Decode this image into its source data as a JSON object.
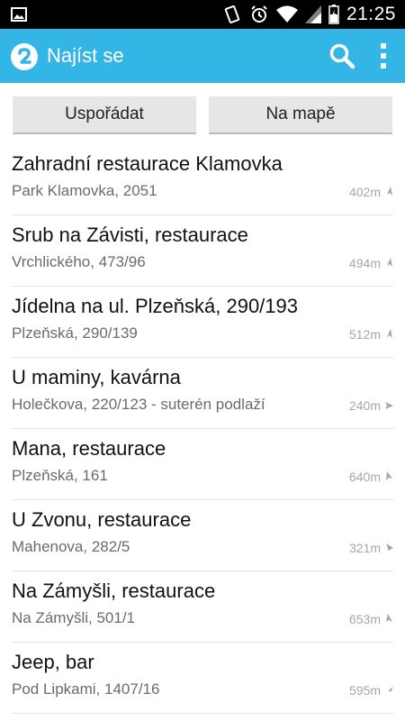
{
  "status_bar": {
    "time": "21:25",
    "icons": [
      "image-icon",
      "vibrate-icon",
      "alarm-icon",
      "wifi-icon",
      "signal-icon",
      "battery-icon"
    ]
  },
  "action_bar": {
    "title": "Najíst se",
    "app_icon": "app-logo-icon",
    "search_icon": "search-icon",
    "overflow_icon": "overflow-menu-icon",
    "color": "#33b5e5"
  },
  "buttons": {
    "sort_label": "Uspořádat",
    "map_label": "Na mapě"
  },
  "restaurants": [
    {
      "name": "Zahradní restaurace Klamovka",
      "address": "Park Klamovka, 2051",
      "distance": "402m",
      "direction_icon": "direction-arrow-icon"
    },
    {
      "name": "Srub na Závisti, restaurace",
      "address": "Vrchlického, 473/96",
      "distance": "494m",
      "direction_icon": "direction-arrow-icon"
    },
    {
      "name": "Jídelna na ul. Plzeňská, 290/193",
      "address": "Plzeňská, 290/139",
      "distance": "512m",
      "direction_icon": "direction-arrow-icon"
    },
    {
      "name": "U maminy, kavárna",
      "address": "Holečkova, 220/123 - suterén podlaží",
      "distance": "240m",
      "direction_icon": "direction-arrow-icon"
    },
    {
      "name": "Mana, restaurace",
      "address": "Plzeňská, 161",
      "distance": "640m",
      "direction_icon": "direction-arrow-icon"
    },
    {
      "name": "U Zvonu, restaurace",
      "address": "Mahenova, 282/5",
      "distance": "321m",
      "direction_icon": "direction-arrow-icon"
    },
    {
      "name": "Na Zámyšli, restaurace",
      "address": "Na Zámyšli, 501/1",
      "distance": "653m",
      "direction_icon": "direction-arrow-icon"
    },
    {
      "name": "Jeep, bar",
      "address": "Pod Lipkami, 1407/16",
      "distance": "595m",
      "direction_icon": "direction-arrow-icon"
    }
  ]
}
